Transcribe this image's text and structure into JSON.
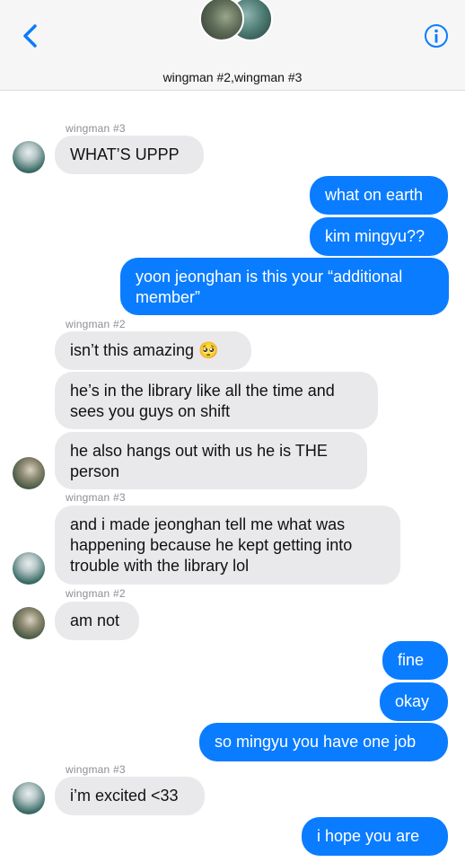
{
  "header": {
    "title": "wingman #2,wingman #3"
  },
  "icons": {
    "back": "chevron-left-icon",
    "info": "info-icon"
  },
  "colors": {
    "accent": "#0a7cff",
    "incoming": "#e9e9eb"
  },
  "messages": [
    {
      "sender_label": "wingman #3",
      "text": "WHAT’S UPPP"
    },
    {
      "text": "what on earth"
    },
    {
      "text": "kim mingyu??"
    },
    {
      "text": "yoon jeonghan is this your “additional member”"
    },
    {
      "sender_label": "wingman #2",
      "text": "isn’t this amazing 🥺"
    },
    {
      "text": "he’s in the library like all the time and sees you guys on shift"
    },
    {
      "text": "he also hangs out with us he is THE person"
    },
    {
      "sender_label": "wingman #3",
      "text": "and i made jeonghan tell me what was happening because he kept getting into trouble with the library lol"
    },
    {
      "sender_label": "wingman #2",
      "text": "am not"
    },
    {
      "text": "fine"
    },
    {
      "text": "okay"
    },
    {
      "text": "so mingyu you have one job"
    },
    {
      "sender_label": "wingman #3",
      "text": "i’m excited <33"
    },
    {
      "text": "i hope you are"
    }
  ]
}
